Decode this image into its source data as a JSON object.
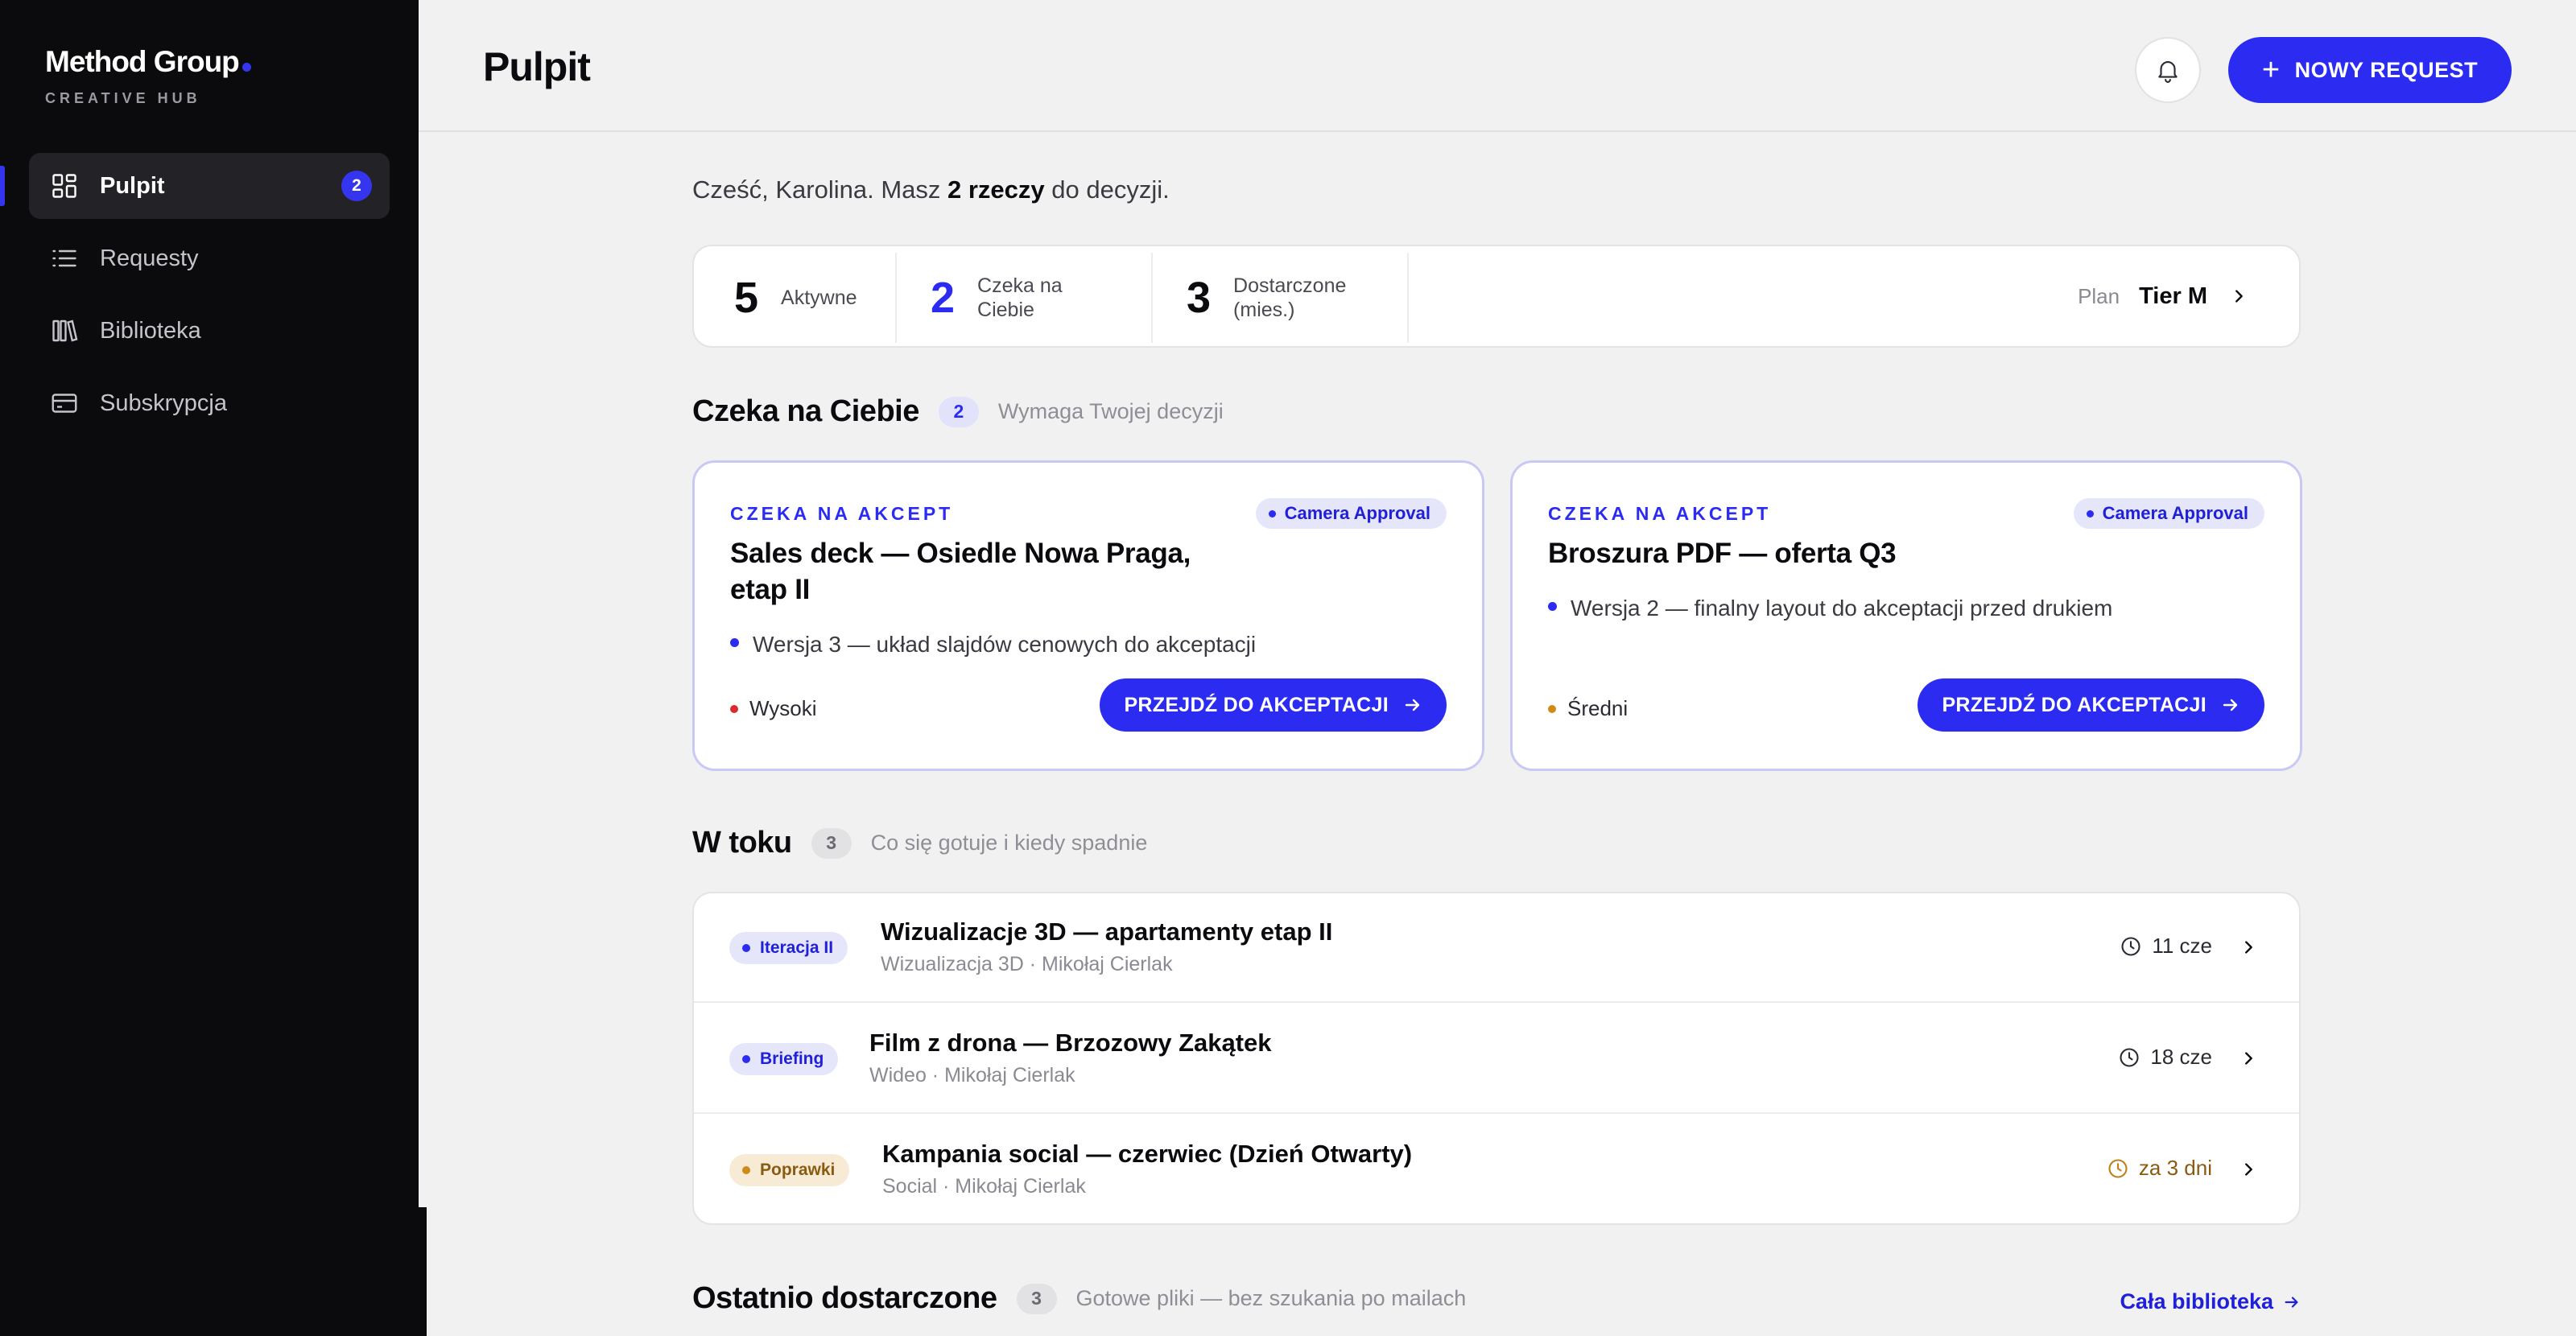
{
  "brand": {
    "name": "Method Group",
    "subtitle": "CREATIVE HUB"
  },
  "sidebar": {
    "items": [
      {
        "label": "Pulpit",
        "icon": "dashboard-icon",
        "active": true,
        "badge": "2"
      },
      {
        "label": "Requesty",
        "icon": "list-icon"
      },
      {
        "label": "Biblioteka",
        "icon": "library-icon"
      },
      {
        "label": "Subskrypcja",
        "icon": "card-icon"
      }
    ]
  },
  "header": {
    "title": "Pulpit",
    "new_button": "NOWY REQUEST",
    "bell_icon": "bell-icon"
  },
  "greeting": {
    "prefix": "Cześć, Karolina. Masz ",
    "highlight": "2 rzeczy",
    "suffix": " do decyzji."
  },
  "stats": {
    "items": [
      {
        "value": "5",
        "label": "Aktywne"
      },
      {
        "value": "2",
        "label": "Czeka na Ciebie"
      },
      {
        "value": "3",
        "label": "Dostarczone (mies.)"
      }
    ],
    "plan_label": "Plan",
    "plan_value": "Tier M"
  },
  "waiting": {
    "title": "Czeka na Ciebie",
    "count": "2",
    "subtitle": "Wymaga Twojej decyzji",
    "cards": [
      {
        "kicker": "CZEKA NA AKCEPT",
        "tag": "Camera Approval",
        "title": "Sales deck — Osiedle Nowa Praga, etap II",
        "note": "Wersja 3 — układ slajdów cenowych do akceptacji",
        "priority": "Wysoki",
        "button": "PRZEJDŹ DO AKCEPTACJI"
      },
      {
        "kicker": "CZEKA NA AKCEPT",
        "tag": "Camera Approval",
        "title": "Broszura PDF — oferta Q3",
        "note": "Wersja 2 — finalny layout do akceptacji przed drukiem",
        "priority": "Średni",
        "button": "PRZEJDŹ DO AKCEPTACJI"
      }
    ]
  },
  "in_progress": {
    "title": "W toku",
    "count": "3",
    "subtitle": "Co się gotuje i kiedy spadnie",
    "rows": [
      {
        "status": "Iteracja II",
        "title": "Wizualizacje 3D — apartamenty etap II",
        "meta": "Wizualizacja 3D · Mikołaj Cierlak",
        "due": "11 cze"
      },
      {
        "status": "Briefing",
        "title": "Film z drona — Brzozowy Zakątek",
        "meta": "Wideo · Mikołaj Cierlak",
        "due": "18 cze"
      },
      {
        "status": "Poprawki",
        "title": "Kampania social — czerwiec (Dzień Otwarty)",
        "meta": "Social · Mikołaj Cierlak",
        "due": "za 3 dni"
      }
    ]
  },
  "delivered": {
    "title": "Ostatnio dostarczone",
    "count": "3",
    "subtitle": "Gotowe pliki — bez szukania po mailach",
    "link": "Cała biblioteka"
  },
  "colors": {
    "accent": "#2b2bf2",
    "sidebar": "#0b0b0d",
    "high": "#d82b2b",
    "medium": "#d08a18"
  }
}
